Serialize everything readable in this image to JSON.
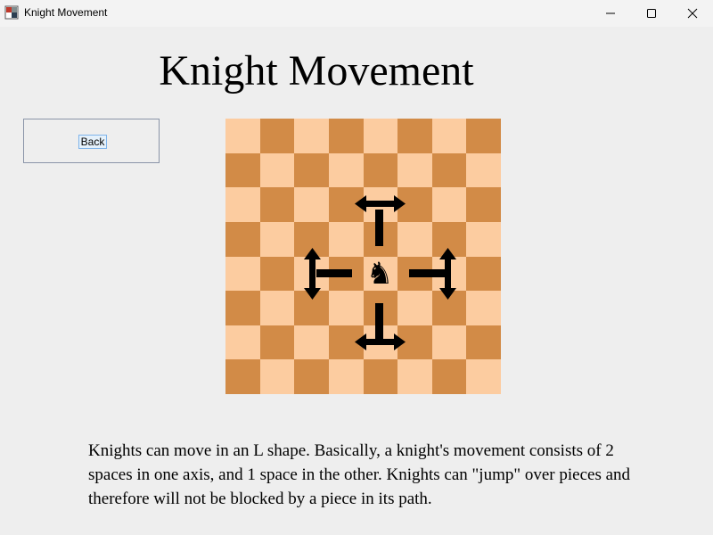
{
  "window": {
    "title": "Knight Movement",
    "icons": [
      "app-icon",
      "minimize-icon",
      "maximize-icon",
      "close-icon"
    ]
  },
  "heading": "Knight Movement",
  "back_button": {
    "label": "Back"
  },
  "board": {
    "size": 8,
    "light_color": "#fccca0",
    "dark_color": "#d28b47",
    "piece": "black-knight",
    "move_arrows": [
      "up-arrow-icon",
      "down-arrow-icon",
      "left-arrow-icon",
      "right-arrow-icon"
    ]
  },
  "description": "Knights can move in an L shape. Basically, a knight's movement consists of 2 spaces in one axis, and 1 space in the other. Knights can \"jump\" over pieces and therefore will not be blocked by a piece in its path."
}
